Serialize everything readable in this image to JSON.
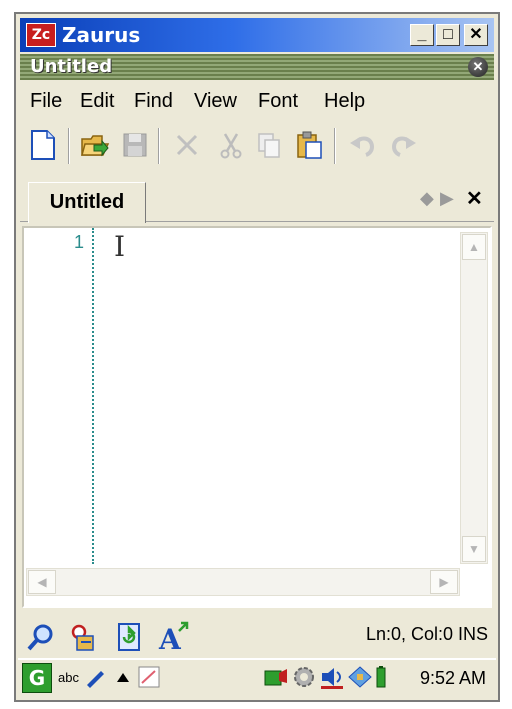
{
  "window": {
    "title": "Zaurus",
    "logo_text": "Zc",
    "minimize_label": "_",
    "maximize_label": "□",
    "close_label": "✕"
  },
  "app": {
    "title": "Untitled",
    "close_label": "✕"
  },
  "menu": {
    "items": [
      {
        "label": "File"
      },
      {
        "label": "Edit"
      },
      {
        "label": "Find"
      },
      {
        "label": "View"
      },
      {
        "label": "Font"
      },
      {
        "label": "Help"
      }
    ]
  },
  "toolbar": {
    "icons": [
      "new-file-icon",
      "open-folder-icon",
      "save-icon",
      "delete-icon",
      "cut-icon",
      "copy-icon",
      "paste-icon",
      "undo-icon",
      "redo-icon"
    ]
  },
  "tabs": {
    "active_label": "Untitled",
    "close_label": "✕"
  },
  "editor": {
    "line_numbers": [
      "1"
    ]
  },
  "status": {
    "position_text": "Ln:0, Col:0 INS",
    "icons": [
      "search-icon",
      "find-replace-icon",
      "goto-icon",
      "font-size-icon"
    ]
  },
  "taskbar": {
    "start_label": "G",
    "input_mode": "abc",
    "time": "9:52 AM",
    "tray_icons": [
      "network-icon",
      "settings-icon",
      "volume-icon",
      "sync-icon",
      "battery-icon"
    ]
  },
  "colors": {
    "title_bar": "#0a3fb8",
    "app_title_bar": "#6a7f4c",
    "line_number": "#2a8c8c",
    "start_button": "#2e9e2e"
  }
}
